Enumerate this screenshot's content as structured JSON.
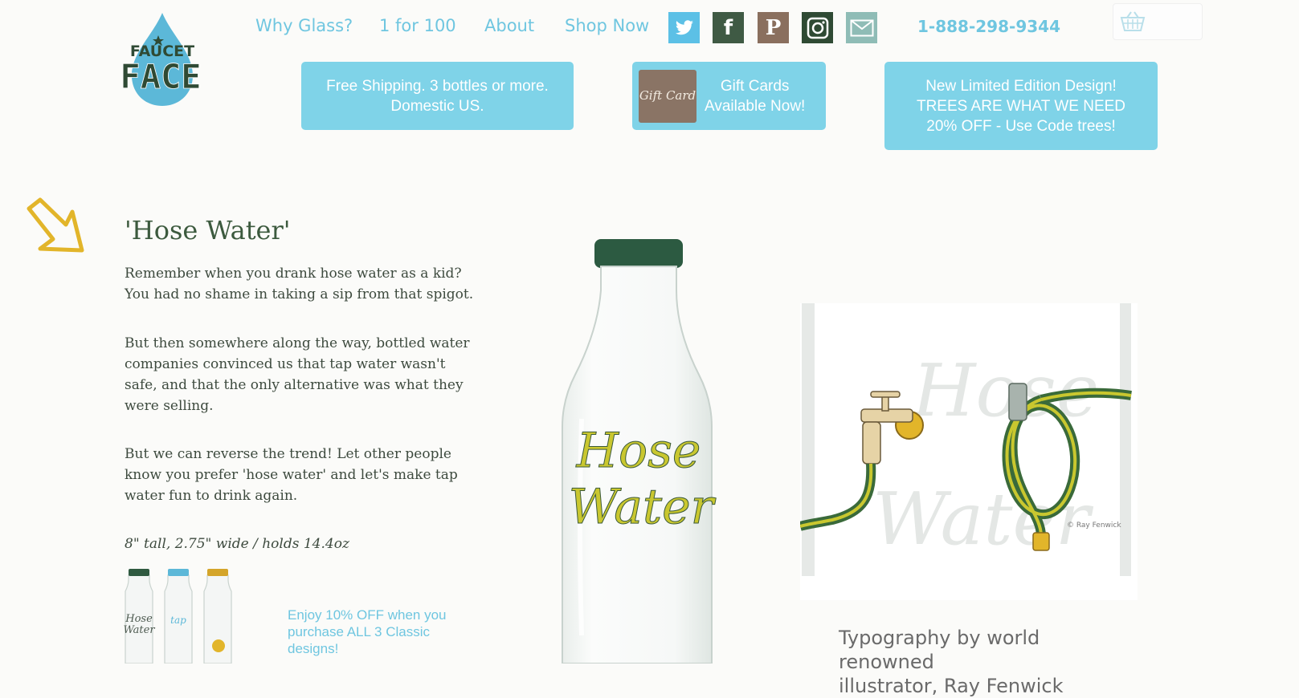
{
  "logo": {
    "line1": "FAUCET",
    "line2": "FACE"
  },
  "nav": {
    "items": [
      {
        "label": "Why Glass?"
      },
      {
        "label": "1 for 100"
      },
      {
        "label": "About"
      },
      {
        "label": "Shop Now"
      }
    ],
    "social": [
      "twitter-icon",
      "facebook-icon",
      "pinterest-icon",
      "instagram-icon",
      "email-icon"
    ],
    "phone": "1-888-298-9344"
  },
  "colors": {
    "accent": "#7fd3e8",
    "brand_green": "#3c5a3e",
    "arrow": "#e2b52a"
  },
  "promos": {
    "shipping": {
      "line1": "Free Shipping. 3 bottles or more.",
      "line2": "Domestic US."
    },
    "gift": {
      "image_text": "Gift Card",
      "line1": "Gift Cards",
      "line2": "Available Now!"
    },
    "limited": {
      "line1": "New Limited Edition Design!",
      "line2": "TREES ARE WHAT WE NEED",
      "line3": "20% OFF - Use Code trees!"
    }
  },
  "product": {
    "title": "'Hose Water'",
    "paragraphs": [
      "Remember when you drank hose water as a kid? You had no shame in taking a sip from that spigot.",
      "But then somewhere along the way, bottled water companies convinced us that tap water wasn't safe, and that the only alternative was what they were selling.",
      "But we can reverse the trend! Let other people know you prefer 'hose water' and let's make tap water fun to drink again."
    ],
    "spec": "8\" tall, 2.75\" wide / holds 14.4oz",
    "bundle_promo": "Enjoy 10% OFF when you purchase ALL 3 Classic designs!",
    "bottle_text_line1": "Hose",
    "bottle_text_line2": "Water",
    "credit": "© Ray Fenwick",
    "caption_line1": "Typography by world renowned",
    "caption_line2": "illustrator, Ray Fenwick"
  }
}
